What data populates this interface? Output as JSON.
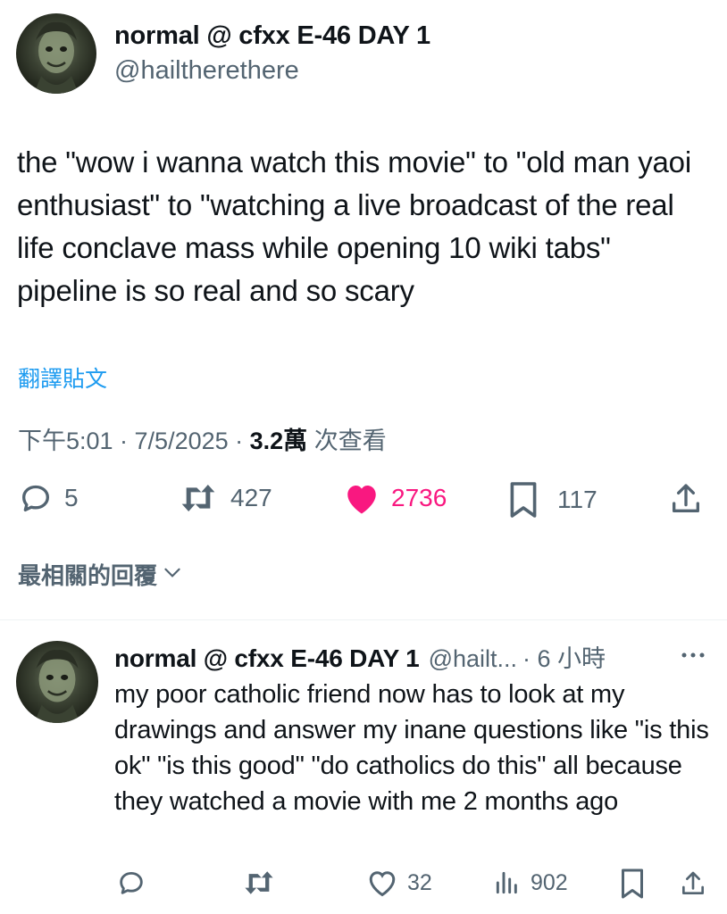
{
  "tweet": {
    "author_name": "normal @ cfxx E-46 DAY 1",
    "author_handle": "@hailtherethere",
    "text": "the \"wow i wanna watch this movie\" to \"old man yaoi enthusiast\" to \"watching a live broadcast of the real life conclave mass while opening 10 wiki tabs\" pipeline is so real and so scary",
    "translate_label": "翻譯貼文",
    "time": "下午5:01 · 7/5/2025 · ",
    "views_count": "3.2萬",
    "views_label": " 次查看",
    "replies": "5",
    "retweets": "427",
    "likes": "2736",
    "bookmarks": "117",
    "icons": [
      "reply-icon",
      "retweet-icon",
      "heart-filled-icon",
      "bookmark-icon",
      "share-icon"
    ],
    "like_color": "#f91880"
  },
  "sort": {
    "label": "最相關的回覆"
  },
  "reply": {
    "author_name": "normal @ cfxx E-46 DAY 1",
    "author_handle": "@hailt...",
    "time": "· 6 小時",
    "text": "my poor catholic friend now has to look at my drawings and answer my inane questions like \"is this ok\" \"is this good\" \"do catholics do this\" all because they watched a movie with me 2 months ago",
    "likes": "32",
    "views": "902",
    "icons": [
      "reply-icon",
      "retweet-icon",
      "heart-icon",
      "views-icon",
      "bookmark-icon",
      "share-icon",
      "more-icon"
    ]
  },
  "colors": {
    "accent": "#1d9bf0",
    "secondary_text": "#536471",
    "primary_text": "#0f1419"
  }
}
